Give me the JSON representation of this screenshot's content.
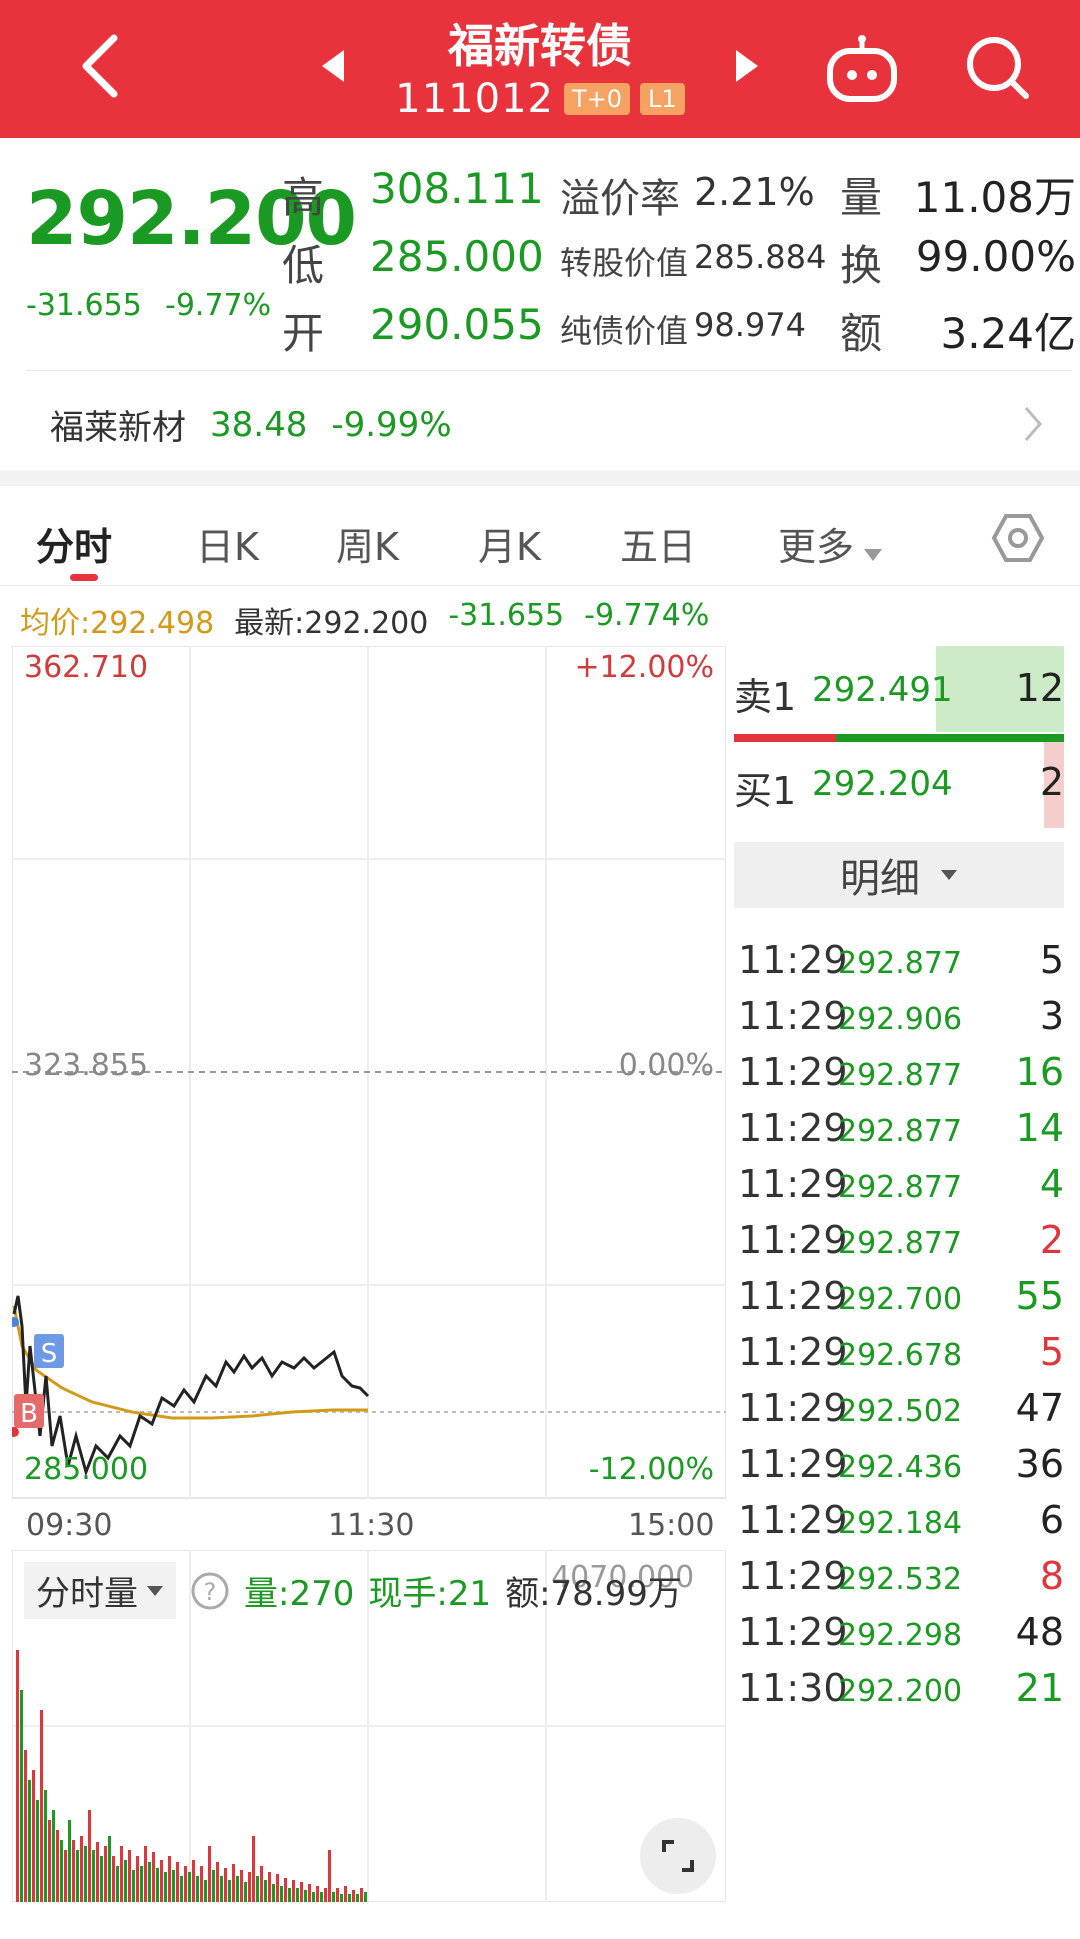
{
  "header": {
    "title": "福新转债",
    "code": "111012",
    "badges": [
      "T+0",
      "L1"
    ]
  },
  "quote": {
    "price": "292.200",
    "change": "-31.655",
    "change_pct": "-9.77%",
    "high_label": "高",
    "high": "308.111",
    "low_label": "低",
    "low": "285.000",
    "open_label": "开",
    "open": "290.055",
    "premium_label": "溢价率",
    "premium": "2.21%",
    "conv_value_label": "转股价值",
    "conv_value": "285.884",
    "bond_value_label": "纯债价值",
    "bond_value": "98.974",
    "volume_label": "量",
    "volume": "11.08万",
    "turnover_label": "换",
    "turnover": "99.00%",
    "amount_label": "额",
    "amount": "3.24亿"
  },
  "underlying": {
    "name": "福莱新材",
    "price": "38.48",
    "change_pct": "-9.99%"
  },
  "tabs": [
    {
      "label": "分时"
    },
    {
      "label": "日K"
    },
    {
      "label": "周K"
    },
    {
      "label": "月K"
    },
    {
      "label": "五日"
    },
    {
      "label": "更多"
    }
  ],
  "info_row": {
    "avg": "均价:292.498",
    "latest": "最新:292.200",
    "change": "-31.655",
    "change_pct": "-9.774%"
  },
  "chart": {
    "top_price": "362.710",
    "top_pct": "+12.00%",
    "mid_price": "323.855",
    "mid_pct": "0.00%",
    "bottom_price": "285.000",
    "bottom_pct": "-12.00%",
    "time_start": "09:30",
    "time_mid": "11:30",
    "time_end": "15:00",
    "marker_s": "S",
    "marker_b": "B"
  },
  "volume_panel": {
    "selector": "分时量",
    "volume": "量:270",
    "current": "现手:21",
    "amount": "额:78.99万",
    "amount_behind": "4070.000"
  },
  "orderbook": {
    "sell_label": "卖1",
    "sell_price": "292.491",
    "sell_vol": "12",
    "buy_label": "买1",
    "buy_price": "292.204",
    "buy_vol": "2",
    "detail_label": "明细"
  },
  "trades": [
    {
      "time": "11:29",
      "price": "292.877",
      "vol": "5",
      "dir": "neutral"
    },
    {
      "time": "11:29",
      "price": "292.906",
      "vol": "3",
      "dir": "neutral"
    },
    {
      "time": "11:29",
      "price": "292.877",
      "vol": "16",
      "dir": "down"
    },
    {
      "time": "11:29",
      "price": "292.877",
      "vol": "14",
      "dir": "down"
    },
    {
      "time": "11:29",
      "price": "292.877",
      "vol": "4",
      "dir": "down"
    },
    {
      "time": "11:29",
      "price": "292.877",
      "vol": "2",
      "dir": "up"
    },
    {
      "time": "11:29",
      "price": "292.700",
      "vol": "55",
      "dir": "down"
    },
    {
      "time": "11:29",
      "price": "292.678",
      "vol": "5",
      "dir": "up"
    },
    {
      "time": "11:29",
      "price": "292.502",
      "vol": "47",
      "dir": "neutral"
    },
    {
      "time": "11:29",
      "price": "292.436",
      "vol": "36",
      "dir": "neutral"
    },
    {
      "time": "11:29",
      "price": "292.184",
      "vol": "6",
      "dir": "neutral"
    },
    {
      "time": "11:29",
      "price": "292.532",
      "vol": "8",
      "dir": "up"
    },
    {
      "time": "11:29",
      "price": "292.298",
      "vol": "48",
      "dir": "neutral"
    },
    {
      "time": "11:30",
      "price": "292.200",
      "vol": "21",
      "dir": "down"
    }
  ],
  "colors": {
    "header_red": "#e8323c",
    "up_red": "#e0353b",
    "down_green": "#1a9a22",
    "avg_yellow": "#d39a1a"
  }
}
